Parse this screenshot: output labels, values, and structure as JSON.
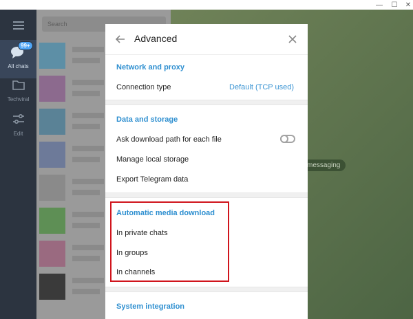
{
  "window": {
    "minimize_glyph": "—",
    "maximize_glyph": "☐",
    "close_glyph": "✕"
  },
  "rail": {
    "items": [
      {
        "label": "All chats",
        "badge": "99+",
        "icon": "chat-bubbles-icon"
      },
      {
        "label": "Techviral",
        "icon": "folder-icon"
      },
      {
        "label": "Edit",
        "icon": "sliders-icon"
      }
    ]
  },
  "chatlist": {
    "search_placeholder": "Search"
  },
  "chat": {
    "pill": "messaging"
  },
  "modal": {
    "title": "Advanced",
    "sections": {
      "network": {
        "title": "Network and proxy",
        "connection_type_label": "Connection type",
        "connection_type_value": "Default (TCP used)"
      },
      "storage": {
        "title": "Data and storage",
        "ask_download_path": "Ask download path for each file",
        "ask_download_path_enabled": false,
        "manage_local_storage": "Manage local storage",
        "export_data": "Export Telegram data"
      },
      "media": {
        "title": "Automatic media download",
        "private_chats": "In private chats",
        "groups": "In groups",
        "channels": "In channels"
      },
      "system": {
        "title": "System integration"
      }
    }
  },
  "colors": {
    "accent": "#2e8fd0",
    "highlight_box": "#d0141c"
  }
}
